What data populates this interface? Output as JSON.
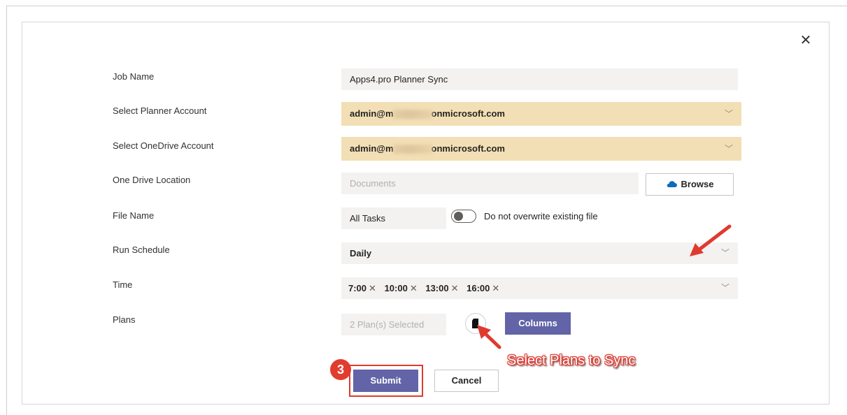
{
  "dialog": {
    "close_label": "✕"
  },
  "form": {
    "job_name": {
      "label": "Job Name",
      "value": "Apps4.pro Planner Sync"
    },
    "planner_account": {
      "label": "Select Planner Account",
      "value_prefix": "admin@m",
      "value_suffix": "onmicrosoft.com"
    },
    "onedrive_account": {
      "label": "Select OneDrive Account",
      "value_prefix": "admin@m",
      "value_suffix": "onmicrosoft.com"
    },
    "onedrive_location": {
      "label": "One Drive Location",
      "placeholder": "Documents",
      "browse_label": "Browse"
    },
    "file_name": {
      "label": "File Name",
      "value": "All Tasks",
      "toggle_label": "Do not overwrite existing file"
    },
    "run_schedule": {
      "label": "Run Schedule",
      "value": "Daily"
    },
    "time": {
      "label": "Time",
      "tags": [
        "7:00",
        "10:00",
        "13:00",
        "16:00"
      ]
    },
    "plans": {
      "label": "Plans",
      "value": "2 Plan(s) Selected",
      "columns_label": "Columns"
    }
  },
  "actions": {
    "submit_label": "Submit",
    "cancel_label": "Cancel"
  },
  "annotations": {
    "step_number": "3",
    "callout": "Select Plans to Sync",
    "accent_color": "#e03a2f"
  },
  "colors": {
    "primary": "#6264a7",
    "highlight": "#f3dfb5",
    "field_bg": "#f3f2f1"
  }
}
